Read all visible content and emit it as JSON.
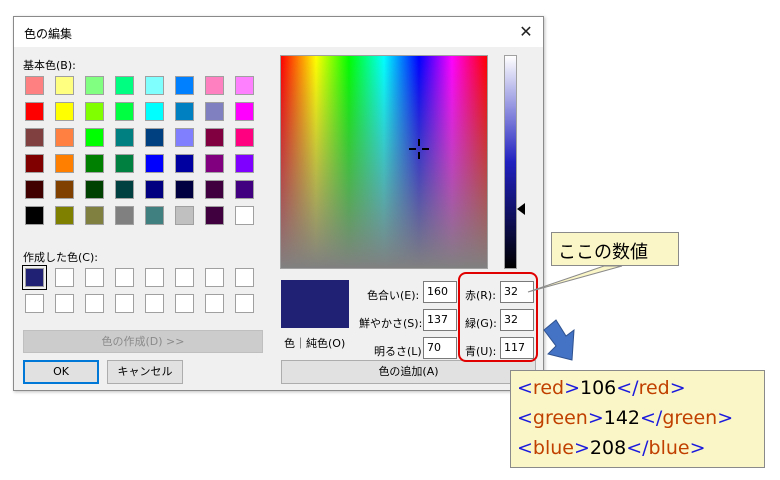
{
  "dialog": {
    "title": "色の編集",
    "close_glyph": "✕",
    "basic_label": "基本色(B):",
    "custom_label": "作成した色(C):",
    "define_button": "色の作成(D) >>",
    "ok_button": "OK",
    "cancel_button": "キャンセル",
    "preview_label": "色｜純色(O)",
    "add_button": "色の追加(A)",
    "fields": {
      "hue": {
        "label": "色合い(E):",
        "value": "160"
      },
      "sat": {
        "label": "鮮やかさ(S):",
        "value": "137"
      },
      "lum": {
        "label": "明るさ(L):",
        "value": "70"
      },
      "red": {
        "label": "赤(R):",
        "value": "32"
      },
      "green": {
        "label": "緑(G):",
        "value": "32"
      },
      "blue": {
        "label": "青(U):",
        "value": "117"
      }
    },
    "preview_color": "#202075",
    "basic_colors": [
      [
        "#ff8080",
        "#ffff80",
        "#80ff80",
        "#00ff80",
        "#80ffff",
        "#0080ff",
        "#ff80c0",
        "#ff80ff"
      ],
      [
        "#ff0000",
        "#ffff00",
        "#80ff00",
        "#00ff40",
        "#00ffff",
        "#0080c0",
        "#8080c0",
        "#ff00ff"
      ],
      [
        "#804040",
        "#ff8040",
        "#00ff00",
        "#008080",
        "#004080",
        "#8080ff",
        "#800040",
        "#ff0080"
      ],
      [
        "#800000",
        "#ff8000",
        "#008000",
        "#008040",
        "#0000ff",
        "#0000a0",
        "#800080",
        "#8000ff"
      ],
      [
        "#400000",
        "#804000",
        "#004000",
        "#004040",
        "#000080",
        "#000040",
        "#400040",
        "#400080"
      ],
      [
        "#000000",
        "#808000",
        "#808040",
        "#808080",
        "#408080",
        "#c0c0c0",
        "#400040",
        "#ffffff"
      ]
    ],
    "custom_colors": [
      [
        "#202075",
        "#ffffff",
        "#ffffff",
        "#ffffff",
        "#ffffff",
        "#ffffff",
        "#ffffff",
        "#ffffff"
      ],
      [
        "#ffffff",
        "#ffffff",
        "#ffffff",
        "#ffffff",
        "#ffffff",
        "#ffffff",
        "#ffffff",
        "#ffffff"
      ]
    ]
  },
  "annotation": {
    "callout_text": "ここの数値",
    "highlight_color": "#e00000",
    "arrow_color": "#4472c4",
    "xml_lines": [
      {
        "open": "<red>",
        "value": "106",
        "close": "</red>",
        "tag": "red"
      },
      {
        "open": "<green>",
        "value": "142",
        "close": "</green>",
        "tag": "green"
      },
      {
        "open": "<blue>",
        "value": "208",
        "close": "</blue>",
        "tag": "blue"
      }
    ]
  }
}
